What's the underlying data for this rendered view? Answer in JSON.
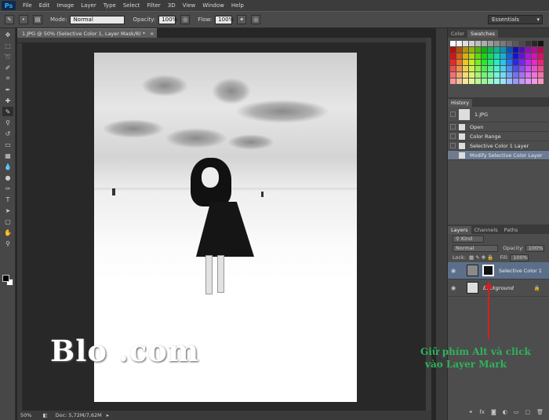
{
  "app": {
    "logo": "Ps"
  },
  "menu": [
    "File",
    "Edit",
    "Image",
    "Layer",
    "Type",
    "Select",
    "Filter",
    "3D",
    "View",
    "Window",
    "Help"
  ],
  "options": {
    "mode_label": "Mode:",
    "mode_value": "Normal",
    "opacity_label": "Opacity:",
    "opacity_value": "100%",
    "flow_label": "Flow:",
    "flow_value": "100%",
    "workspace": "Essentials"
  },
  "document": {
    "tab_title": "1.JPG @ 50% (Selective Color 1, Layer Mask/8) *",
    "zoom": "50%",
    "doc_info": "Doc: 5,72M/7,62M"
  },
  "color_panel": {
    "tab_color": "Color",
    "tab_swatches": "Swatches"
  },
  "history": {
    "tab": "History",
    "snapshot": "1.JPG",
    "items": [
      "Open",
      "Color Range",
      "Selective Color 1 Layer",
      "Modify Selective Color Layer"
    ]
  },
  "layers_panel": {
    "tabs": [
      "Layers",
      "Channels",
      "Paths"
    ],
    "kind": "Kind",
    "blend_mode": "Normal",
    "opacity_label": "Opacity:",
    "opacity_value": "100%",
    "lock_label": "Lock:",
    "fill_label": "Fill:",
    "fill_value": "100%",
    "layers": [
      {
        "name": "Selective Color 1"
      },
      {
        "name": "Background"
      }
    ]
  },
  "watermark": "Blo                          .com",
  "annotation": {
    "line1": "Giữ phím Alt và click",
    "line2": "vào Layer Mark",
    "color": "#2fb35a"
  },
  "colors": {
    "accent_arrow": "#d31f1f",
    "selection": "#5c6f8a"
  }
}
